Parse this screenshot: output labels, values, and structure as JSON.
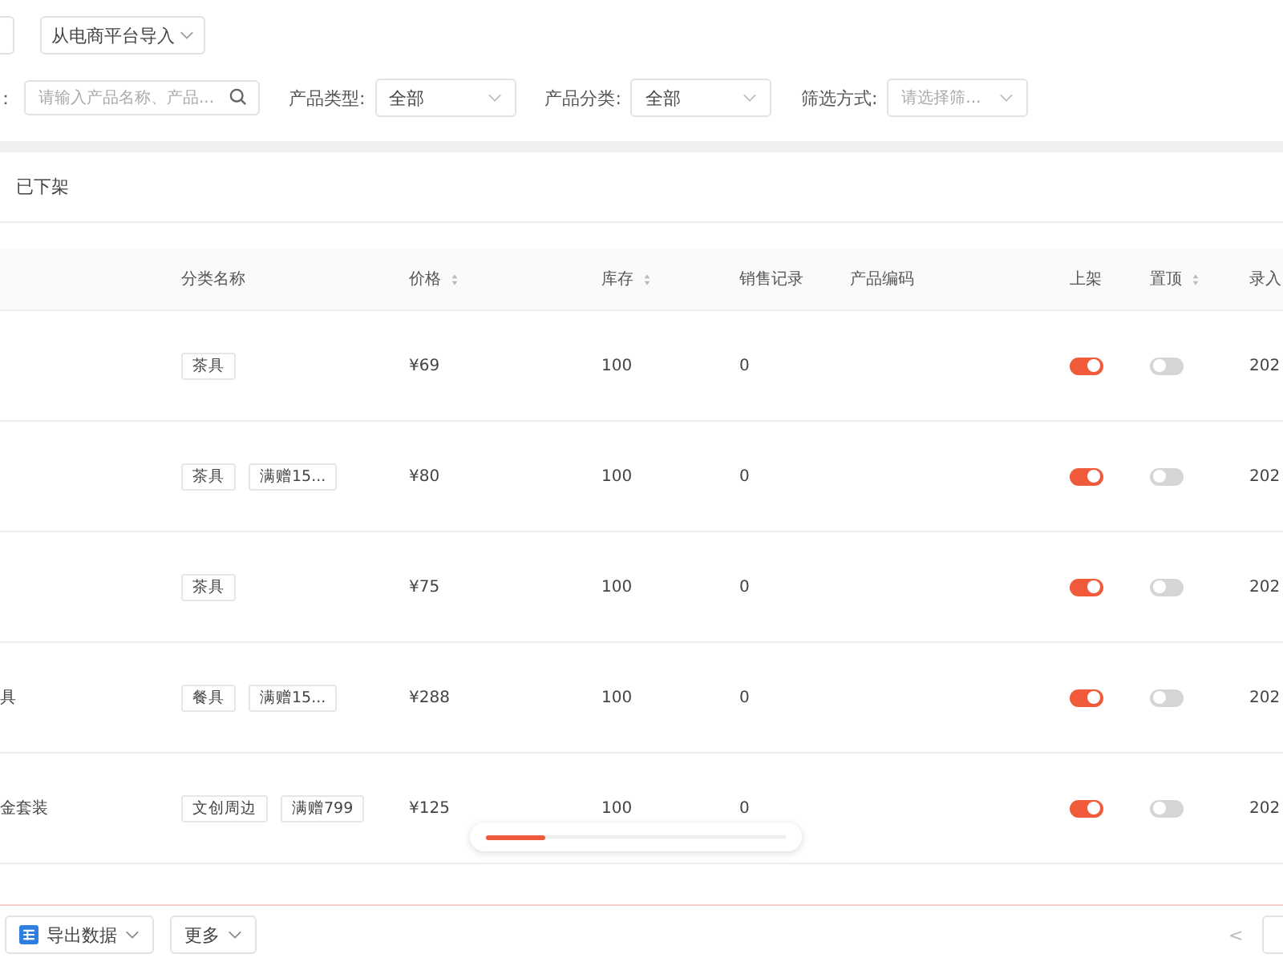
{
  "toolbar": {
    "import_button": "从电商平台导入"
  },
  "filters": {
    "search": {
      "label": "：",
      "placeholder": "请输入产品名称、产品..."
    },
    "selects": [
      {
        "label": "产品类型:",
        "value": "全部"
      },
      {
        "label": "产品分类:",
        "value": "全部"
      },
      {
        "label": "筛选方式:",
        "placeholder": "请选择筛..."
      }
    ]
  },
  "tabs": [
    {
      "label": "已下架",
      "selected": false
    }
  ],
  "table": {
    "columns": [
      {
        "label": "分类名称",
        "sortable": false
      },
      {
        "label": "价格",
        "sortable": true
      },
      {
        "label": "库存",
        "sortable": true
      },
      {
        "label": "销售记录",
        "sortable": false
      },
      {
        "label": "产品编码",
        "sortable": false
      },
      {
        "label": "上架",
        "sortable": false
      },
      {
        "label": "置顶",
        "sortable": true
      },
      {
        "label": "录入"
      }
    ],
    "rows": [
      {
        "name": "",
        "tags": [
          "茶具"
        ],
        "price": "¥69",
        "stock": "100",
        "sales": "0",
        "on_shelf": true,
        "pinned": false,
        "date": "202"
      },
      {
        "name": "",
        "tags": [
          "茶具",
          "满赠15..."
        ],
        "price": "¥80",
        "stock": "100",
        "sales": "0",
        "on_shelf": true,
        "pinned": false,
        "date": "202"
      },
      {
        "name": "",
        "tags": [
          "茶具"
        ],
        "price": "¥75",
        "stock": "100",
        "sales": "0",
        "on_shelf": true,
        "pinned": false,
        "date": "202"
      },
      {
        "name": "具",
        "tags": [
          "餐具",
          "满赠15..."
        ],
        "price": "¥288",
        "stock": "100",
        "sales": "0",
        "on_shelf": true,
        "pinned": false,
        "date": "202"
      },
      {
        "name": "金套装",
        "tags": [
          "文创周边",
          "满赠799"
        ],
        "price": "¥125",
        "stock": "100",
        "sales": "0",
        "on_shelf": true,
        "pinned": false,
        "date": "202"
      }
    ]
  },
  "footer": {
    "buttons": [
      {
        "label": "导出数据",
        "kind": "icon"
      },
      {
        "label": "更多",
        "kind": "plain"
      }
    ],
    "pager_prev": "<"
  }
}
